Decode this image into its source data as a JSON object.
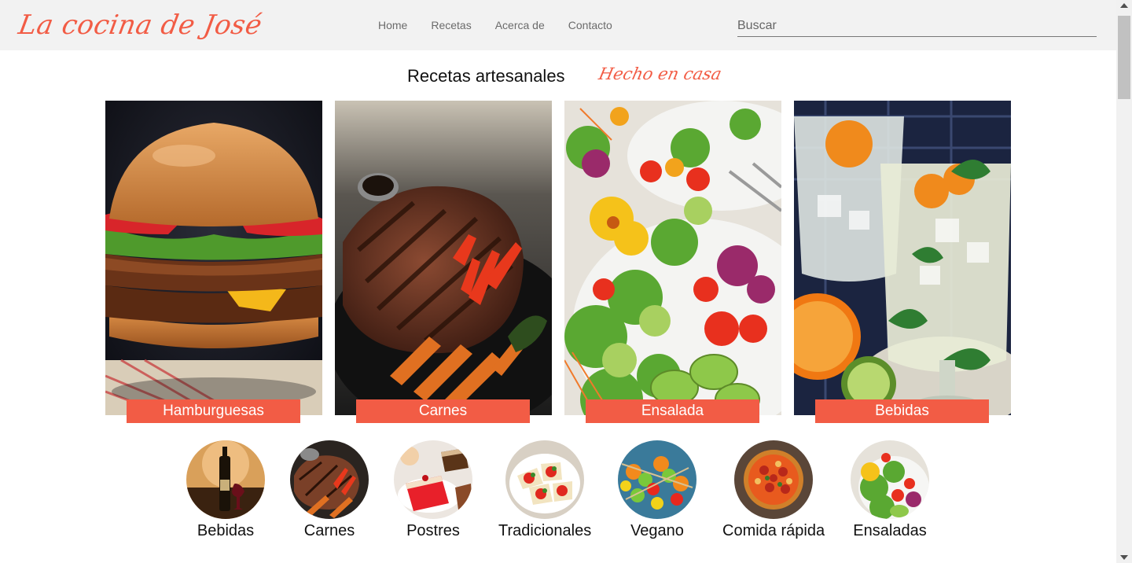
{
  "header": {
    "logo": "La cocina de José",
    "nav": [
      "Home",
      "Recetas",
      "Acerca de",
      "Contacto"
    ],
    "search_placeholder": "Buscar"
  },
  "hero": {
    "title": "Recetas artesanales",
    "tagline": "Hecho en casa"
  },
  "cards": [
    {
      "label": "Hamburguesas",
      "icon": "burger-photo"
    },
    {
      "label": "Carnes",
      "icon": "steak-photo"
    },
    {
      "label": "Ensalada",
      "icon": "salad-photo"
    },
    {
      "label": "Bebidas",
      "icon": "drinks-photo"
    }
  ],
  "categories": [
    {
      "label": "Bebidas",
      "icon": "wine-photo"
    },
    {
      "label": "Carnes",
      "icon": "steak-photo"
    },
    {
      "label": "Postres",
      "icon": "desserts-photo"
    },
    {
      "label": "Tradicionales",
      "icon": "pasta-photo"
    },
    {
      "label": "Vegano",
      "icon": "vegan-skewers-photo"
    },
    {
      "label": "Comida rápida",
      "icon": "pizza-photo"
    },
    {
      "label": "Ensaladas",
      "icon": "salad-photo"
    }
  ],
  "colors": {
    "accent": "#f25c45",
    "header_bg": "#f2f2f2",
    "nav_text": "#6b6b6b"
  }
}
